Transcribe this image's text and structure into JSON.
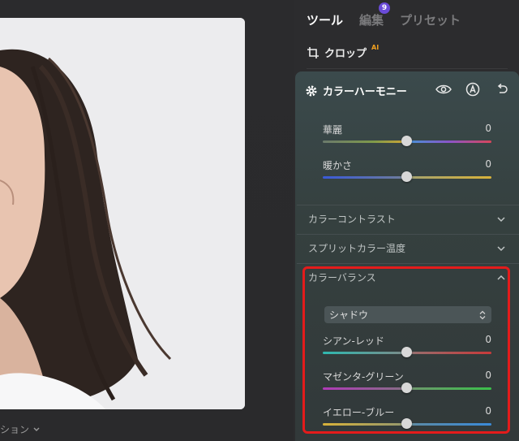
{
  "tabs": [
    {
      "label": "ツール"
    },
    {
      "label": "編集",
      "badge": "9"
    },
    {
      "label": "プリセット"
    }
  ],
  "crop": {
    "label": "クロップ",
    "ai": "AI"
  },
  "color_harmony": {
    "title": "カラーハーモニー",
    "sliders": [
      {
        "label": "華麗",
        "value": "0",
        "level": 0.5
      },
      {
        "label": "暖かさ",
        "value": "0",
        "level": 0.5
      }
    ]
  },
  "collapsed_sections": [
    {
      "label": "カラーコントラスト"
    },
    {
      "label": "スプリットカラー温度"
    }
  ],
  "color_balance": {
    "title": "カラーバランス",
    "select_value": "シャドウ",
    "sliders": [
      {
        "label": "シアン-レッド",
        "value": "0",
        "level": 0.5
      },
      {
        "label": "マゼンタ-グリーン",
        "value": "0",
        "level": 0.5
      },
      {
        "label": "イエロー-ブルー",
        "value": "0",
        "level": 0.5
      }
    ]
  },
  "bottom_label": "ション"
}
